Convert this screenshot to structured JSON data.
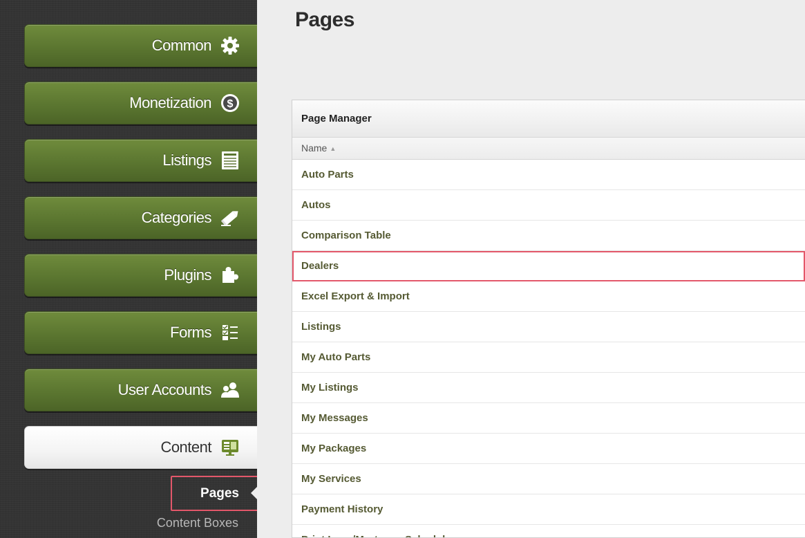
{
  "sidebar": {
    "items": [
      {
        "label": "Common",
        "icon": "gear-icon",
        "active": false
      },
      {
        "label": "Monetization",
        "icon": "dollar-coin-icon",
        "active": false
      },
      {
        "label": "Listings",
        "icon": "listings-icon",
        "active": false
      },
      {
        "label": "Categories",
        "icon": "pencil-icon",
        "active": false
      },
      {
        "label": "Plugins",
        "icon": "puzzle-icon",
        "active": false
      },
      {
        "label": "Forms",
        "icon": "checklist-icon",
        "active": false
      },
      {
        "label": "User Accounts",
        "icon": "users-icon",
        "active": false
      },
      {
        "label": "Content",
        "icon": "monitor-icon",
        "active": true
      }
    ],
    "subitems": [
      {
        "label": "Pages",
        "selected": true
      },
      {
        "label": "Content Boxes",
        "selected": false
      }
    ]
  },
  "main": {
    "title": "Pages",
    "panel_title": "Page Manager",
    "column_header": "Name",
    "sort_indicator": "▲",
    "rows": [
      "Auto Parts",
      "Autos",
      "Comparison Table",
      "Dealers",
      "Excel Export & Import",
      "Listings",
      "My Auto Parts",
      "My Listings",
      "My Messages",
      "My Packages",
      "My Services",
      "Payment History",
      "Print Loan/Mortgage Schedule"
    ],
    "highlighted_row": "Dealers"
  },
  "colors": {
    "nav_green": "#5b7630",
    "link_text": "#555a33",
    "highlight": "#e3576a",
    "sidebar_bg": "#343434"
  }
}
